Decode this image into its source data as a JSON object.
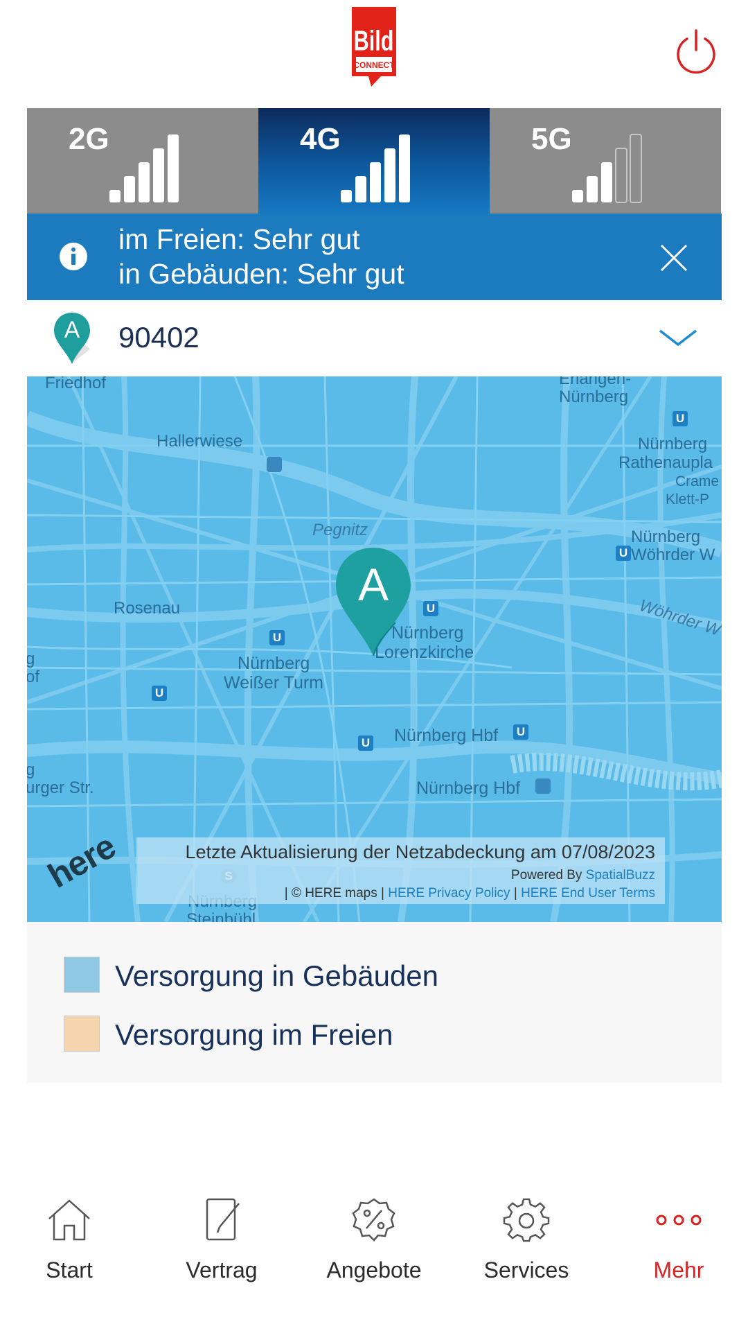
{
  "header": {
    "logo_text": "Bild CONNECT",
    "power_icon": "power-icon"
  },
  "tabs": [
    {
      "label": "2G",
      "bars_filled": 5,
      "active": false
    },
    {
      "label": "4G",
      "bars_filled": 5,
      "active": true
    },
    {
      "label": "5G",
      "bars_filled": 3,
      "active": false
    }
  ],
  "banner": {
    "line1": "im Freien: Sehr gut",
    "line2": "in Gebäuden: Sehr gut"
  },
  "location": {
    "marker_letter": "A",
    "zip": "90402"
  },
  "map": {
    "marker_letter": "A",
    "labels": {
      "friedhof": "Friedhof",
      "erlangen": "Erlangen-",
      "nuernberg_top": "Nürnberg",
      "hallerwiese": "Hallerwiese",
      "rathenau1": "Nürnberg",
      "rathenau2": "Rathenaupla",
      "crame1": "Crame",
      "crame2": "Klett-P",
      "woehrder1": "Nürnberg",
      "woehrder2": "Wöhrder W",
      "pegnitz": "Pegnitz",
      "rosenau": "Rosenau",
      "woehrderwiese": "Wöhrder W",
      "lorenz1": "Nürnberg",
      "lorenz2": "Lorenzkirche",
      "weisser1": "Nürnberg",
      "weisser2": "Weißer Turm",
      "hbf1": "Nürnberg Hbf",
      "hbf2": "Nürnberg Hbf",
      "left_g": "g",
      "left_of": "of",
      "left_g2": "g",
      "burgerstr": "urger Str.",
      "steinbuehl1": "Nürnberg",
      "steinbuehl2": "Steinbühl",
      "u": "U",
      "s": "S"
    },
    "attribution": {
      "updated": "Letzte Aktualisierung der Netzabdeckung am 07/08/2023",
      "powered_prefix": "Powered By ",
      "powered_link": "SpatialBuzz",
      "copyright": "| © HERE maps | ",
      "privacy": "HERE Privacy Policy",
      "sep": " | ",
      "terms": "HERE End User Terms"
    },
    "here_logo": "here"
  },
  "legend": [
    {
      "label": "Versorgung in Gebäuden",
      "color": "#90c9e6"
    },
    {
      "label": "Versorgung im Freien",
      "color": "#f5d5ad"
    }
  ],
  "nav": [
    {
      "label": "Start",
      "icon": "home-icon",
      "active": false
    },
    {
      "label": "Vertrag",
      "icon": "contract-icon",
      "active": false
    },
    {
      "label": "Angebote",
      "icon": "percent-badge-icon",
      "active": false
    },
    {
      "label": "Services",
      "icon": "gear-icon",
      "active": false
    },
    {
      "label": "Mehr",
      "icon": "more-dots-icon",
      "active": true
    }
  ],
  "colors": {
    "accent_red": "#d92121",
    "banner_blue": "#1c7bbf",
    "navy": "#17315a"
  }
}
